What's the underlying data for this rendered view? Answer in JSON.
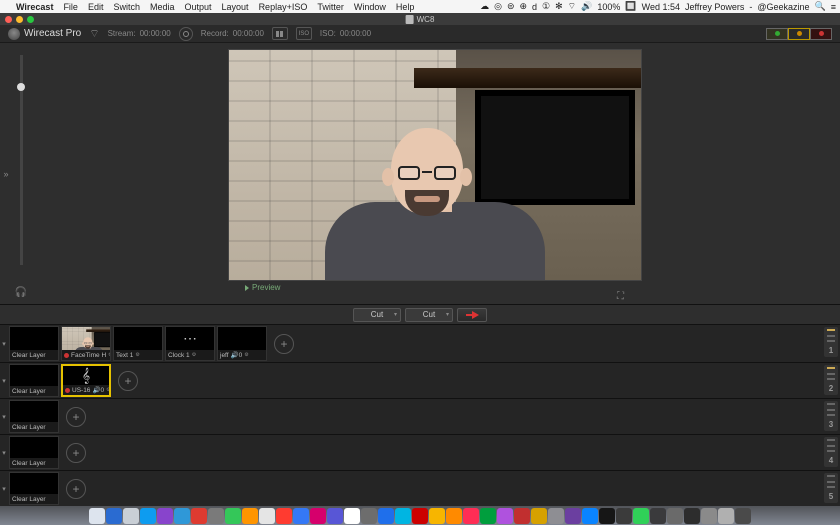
{
  "menubar": {
    "app_name": "Wirecast",
    "items": [
      "File",
      "Edit",
      "Switch",
      "Media",
      "Output",
      "Layout",
      "Replay+ISO",
      "Twitter",
      "Window",
      "Help"
    ],
    "right": {
      "icons": [
        "☁",
        "◎",
        "⊜",
        "⊕",
        "d",
        "①",
        "✻",
        "⌔",
        "🔊",
        "100%",
        "🔲"
      ],
      "clock": "Wed 1:54",
      "user": "Jeffrey Powers",
      "handle": "@Geekazine",
      "menu_icon": "≡"
    }
  },
  "window": {
    "title": "WC8"
  },
  "toolbar": {
    "brand": "Wirecast Pro",
    "stream": {
      "label": "Stream:",
      "time": "00:00:00"
    },
    "record": {
      "label": "Record:",
      "time": "00:00:00"
    },
    "iso": {
      "label": "ISO:",
      "time": "00:00:00"
    }
  },
  "preview": {
    "label": "Preview"
  },
  "transitions": {
    "left": "Cut",
    "right": "Cut"
  },
  "layers": {
    "rows": [
      {
        "num": "1",
        "shots": [
          {
            "label": "Clear Layer",
            "live": false
          },
          {
            "label": "FaceTime H",
            "live": true,
            "gear": true,
            "thumb": true
          },
          {
            "label": "Text 1",
            "live": false,
            "gear": true
          },
          {
            "label": "Clock 1",
            "live": false,
            "gear": true,
            "glyph": "⋯"
          },
          {
            "label": "jeff",
            "live": false,
            "gear": true,
            "audio": "0"
          }
        ]
      },
      {
        "num": "2",
        "shots": [
          {
            "label": "Clear Layer",
            "live": false
          },
          {
            "label": "US-16",
            "live": true,
            "gear": true,
            "audio": "0",
            "glyph": "𝄞",
            "selected": true
          }
        ]
      },
      {
        "num": "3",
        "shots": [
          {
            "label": "Clear Layer",
            "live": false
          }
        ]
      },
      {
        "num": "4",
        "shots": [
          {
            "label": "Clear Layer",
            "live": false
          }
        ]
      },
      {
        "num": "5",
        "shots": [
          {
            "label": "Clear Layer",
            "live": false
          }
        ]
      }
    ]
  },
  "dock": {
    "colors": [
      "#dde4ee",
      "#2a6bd1",
      "#c9cfd6",
      "#0d9cf0",
      "#8844cc",
      "#2f98d8",
      "#de3b30",
      "#7a7a7a",
      "#34c759",
      "#ff9500",
      "#e5e5e5",
      "#ff3b30",
      "#3478f6",
      "#d6006c",
      "#5856d6",
      "#ffffff",
      "#6d6d6d",
      "#1f6feb",
      "#00b5e2",
      "#cc0000",
      "#f7b500",
      "#ff8a00",
      "#ff2d55",
      "#009e3d",
      "#af52de",
      "#c12f2f",
      "#d6a100",
      "#8e8e93",
      "#6b3fa0",
      "#0a84ff",
      "#161616",
      "#3b3b3b",
      "#30d158",
      "#3a3a3c",
      "#6a6a6a",
      "#2d2d2d",
      "#8a8a8a",
      "#b0b0b0",
      "#4a4a4a"
    ]
  }
}
